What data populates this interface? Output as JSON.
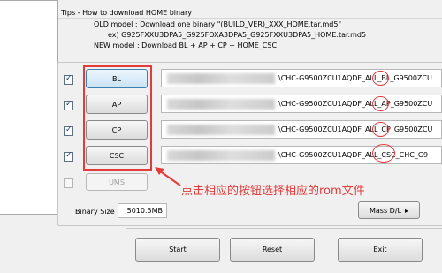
{
  "tips": {
    "title": "Tips - How to download HOME binary",
    "old_model": "OLD model  : Download one binary   \"(BUILD_VER)_XXX_HOME.tar.md5\"",
    "ex": "ex) G925FXXU3DPA5_G925FOXA3DPA5_G925FXXU3DPA5_HOME.tar.md5",
    "new_model": "NEW model : Download BL + AP + CP + HOME_CSC"
  },
  "files": [
    {
      "label": "BL",
      "checked": true,
      "path_prefix": "\\CHC-G9500ZCU1AQDF_ALL_",
      "highlight": "BL",
      "path_suffix": "_G9500ZCU"
    },
    {
      "label": "AP",
      "checked": true,
      "path_prefix": "\\CHC-G9500ZCU1AQDF_ALL_",
      "highlight": "AP",
      "path_suffix": "_G9500ZCU"
    },
    {
      "label": "CP",
      "checked": true,
      "path_prefix": "\\CHC-G9500ZCU1AQDF_ALL_",
      "highlight": "CP",
      "path_suffix": "_G9500ZCU"
    },
    {
      "label": "CSC",
      "checked": true,
      "path_prefix": "\\CHC-G9500ZCU1AQDF_ALL_",
      "highlight": "CSC",
      "path_suffix": "_CHC_G9"
    }
  ],
  "ums": {
    "label": "UMS",
    "checked": false
  },
  "annotation": "点击相应的按钮选择相应的rom文件",
  "binary_size": {
    "label": "Binary Size",
    "value": "5010.5MB"
  },
  "mass_dl": {
    "label": "Mass D/L"
  },
  "actions": {
    "start": "Start",
    "reset": "Reset",
    "exit": "Exit"
  },
  "colors": {
    "highlight_red": "#e33b3b",
    "bl_button": "#c9e3f6"
  },
  "check_mark": "✓",
  "play_glyph": "▸"
}
